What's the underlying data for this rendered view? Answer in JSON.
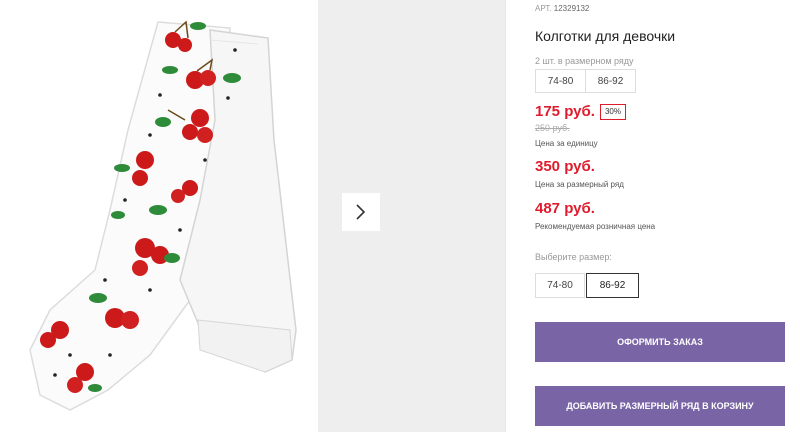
{
  "gallery": {
    "main_image": "white tights with cherry pattern",
    "next_icon": "chevron-right-icon"
  },
  "product": {
    "article_label": "АРТ.",
    "article_number": "12329132",
    "title": "Колготки для девочки",
    "set_label": "2 шт. в размерном ряду",
    "set_sizes": [
      "74-80",
      "86-92"
    ]
  },
  "pricing": {
    "unit_price": "175 руб.",
    "discount": "30%",
    "old_price": "250 руб.",
    "unit_caption": "Цена за единицу",
    "set_price": "350 руб.",
    "set_caption": "Цена за размерный ряд",
    "retail_price": "487 руб.",
    "retail_caption": "Рекомендуемая розничная цена",
    "price_color": "#e01b2d"
  },
  "size_select": {
    "label": "Выберите размер:",
    "options": [
      "74-80",
      "86-92"
    ],
    "selected": "86-92"
  },
  "actions": {
    "order_label": "Оформить заказ",
    "cart_label": "Добавить размерный ряд в корзину",
    "button_color": "#7965a6"
  }
}
